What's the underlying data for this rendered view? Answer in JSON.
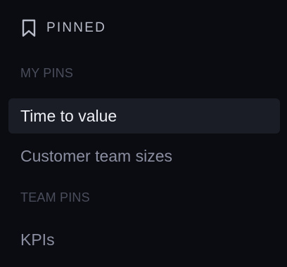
{
  "header": {
    "icon": "bookmark-icon",
    "title": "PINNED"
  },
  "sections": [
    {
      "label": "MY PINS",
      "items": [
        {
          "label": "Time to value",
          "active": true
        },
        {
          "label": "Customer team sizes",
          "active": false
        }
      ]
    },
    {
      "label": "TEAM PINS",
      "items": [
        {
          "label": "KPIs",
          "active": false
        }
      ]
    }
  ],
  "colors": {
    "background": "#0b0c11",
    "active_item_bg": "#1b1d26",
    "header_text": "#b9bcc9",
    "section_label": "#4a4d5b",
    "item_text": "#8b8ea0",
    "active_item_text": "#eceef4"
  }
}
